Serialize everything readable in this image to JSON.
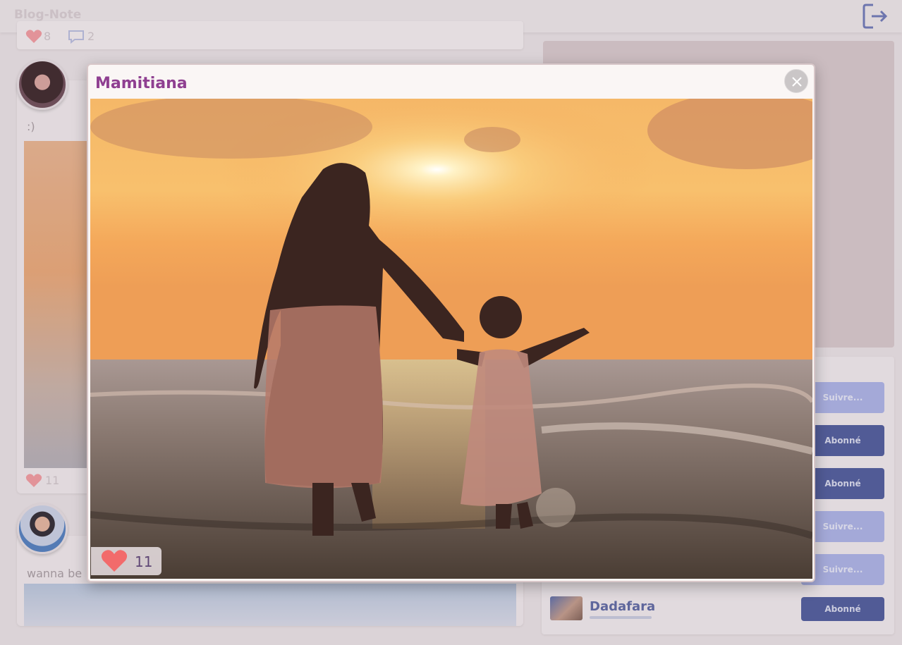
{
  "app": {
    "title": "Blog-Note"
  },
  "feed": {
    "top_card": {
      "likes": "8",
      "comments": "2"
    },
    "post1": {
      "text": ":)",
      "likes": "11"
    },
    "post2": {
      "text": "wanna be"
    }
  },
  "sidebar": {
    "follow_buttons": [
      "Suivre...",
      "Abonné",
      "Abonné",
      "Suivre...",
      "Suivre...",
      "Abonné"
    ],
    "user_name": "Dadafara"
  },
  "modal": {
    "author": "Mamitiana",
    "likes": "11"
  },
  "colors": {
    "accent": "#8f3f91",
    "follow": "#aab3e8",
    "subscribed": "#4c5a9c",
    "like_red": "#f26b6b"
  },
  "icons": {
    "logout": "logout-icon",
    "close": "close-icon",
    "heart": "heart-icon",
    "comment": "comment-icon"
  }
}
